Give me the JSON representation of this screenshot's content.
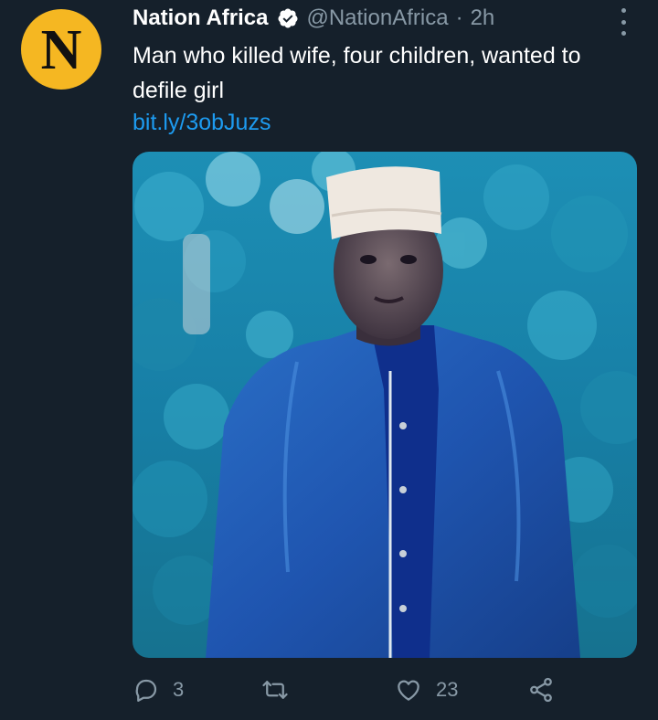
{
  "tweet": {
    "author": {
      "display_name": "Nation Africa",
      "handle": "@NationAfrica",
      "avatar_letter": "N",
      "verified": true
    },
    "separator": "·",
    "timestamp": "2h",
    "text": "Man who killed wife, four children, wanted to defile girl",
    "link": "bit.ly/3obJuzs",
    "media": {
      "description_icon": "photo-man-in-blue-jacket-and-white-cap"
    },
    "actions": {
      "reply_count": "3",
      "retweet_count": "",
      "like_count": "23"
    }
  },
  "colors": {
    "background": "#15202b",
    "text": "#ffffff",
    "muted": "#8899a6",
    "link": "#1d9bf0",
    "avatar_bg": "#f5b722"
  }
}
